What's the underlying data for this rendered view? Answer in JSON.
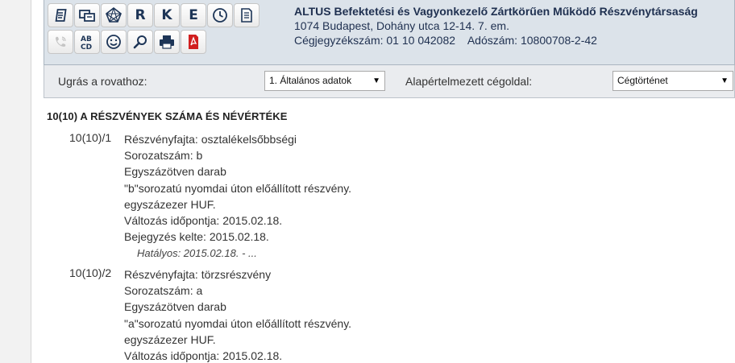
{
  "company": {
    "name": "ALTUS Befektetési és Vagyonkezelő Zártkörűen Működő Részvénytársaság",
    "address": "1074 Budapest, Dohány utca 12-14. 7. em.",
    "registry_label": "Cégjegyzékszám:",
    "registry_number": "01 10 042082",
    "tax_label": "Adószám:",
    "tax_number": "10800708-2-42"
  },
  "toolbar": {
    "row1": [
      {
        "name": "document-list-icon",
        "label": ""
      },
      {
        "name": "transfer-icon",
        "label": ""
      },
      {
        "name": "network-icon",
        "label": ""
      },
      {
        "name": "r-button",
        "label": "R"
      },
      {
        "name": "k-button",
        "label": "K"
      },
      {
        "name": "e-button",
        "label": "E"
      },
      {
        "name": "clock-icon",
        "label": ""
      },
      {
        "name": "page-icon",
        "label": ""
      }
    ],
    "row2": [
      {
        "name": "phone-icon",
        "label": ""
      },
      {
        "name": "abcd-icon",
        "label": "AB CD"
      },
      {
        "name": "smiley-icon",
        "label": ""
      },
      {
        "name": "search-icon",
        "label": ""
      },
      {
        "name": "printer-icon",
        "label": ""
      },
      {
        "name": "pdf-icon",
        "label": ""
      }
    ]
  },
  "navbar": {
    "jump_label": "Ugrás a rovathoz:",
    "jump_selected": "1. Általános adatok",
    "default_label": "Alapértelmezett cégoldal:",
    "default_selected": "Cégtörténet"
  },
  "section": {
    "title": "10(10) A RÉSZVÉNYEK SZÁMA ÉS NÉVÉRTÉKE",
    "entries": [
      {
        "number": "10(10)/1",
        "lines": [
          "Részvényfajta: osztalékelsőbbségi",
          "Sorozatszám: b",
          "Egyszázötven darab",
          "\"b\"sorozatú nyomdai úton előállított részvény.",
          "egyszázezer HUF.",
          "Változás időpontja: 2015.02.18.",
          "Bejegyzés kelte: 2015.02.18."
        ],
        "hatalyos": "Hatályos: 2015.02.18. - ..."
      },
      {
        "number": "10(10)/2",
        "lines": [
          "Részvényfajta: törzsrészvény",
          "Sorozatszám: a",
          "Egyszázötven darab",
          "\"a\"sorozatú nyomdai úton előállított részvény.",
          "egyszázezer HUF.",
          "Változás időpontja: 2015.02.18."
        ]
      }
    ]
  },
  "colors": {
    "header_bg": "#dce3ea",
    "company_text": "#1f3050",
    "icon_blue": "#1d3557",
    "pdf_red": "#d11f1f"
  }
}
